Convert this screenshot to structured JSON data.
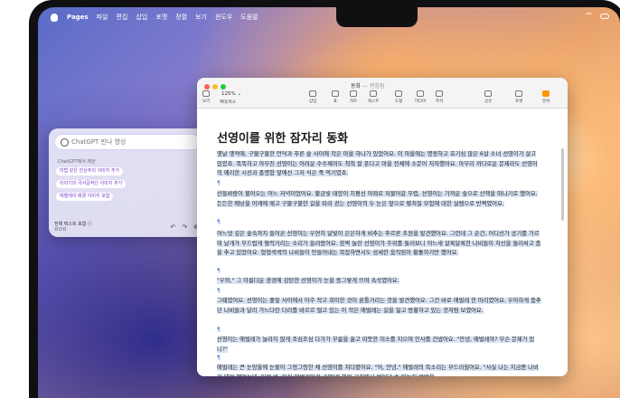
{
  "menubar": {
    "items": [
      "Pages",
      "파일",
      "편집",
      "삽입",
      "포맷",
      "정렬",
      "보기",
      "윈도우",
      "도움말"
    ]
  },
  "writing_tools": {
    "prompt_placeholder": "ChatGPT 만나 향상",
    "caption": "ChatGPT에서 제안",
    "suggestions": [
      "마법 같은 민상주의 이미지 추가",
      "이야기의 극서길적인 이미지 추가",
      "에벨레의 배경 이미지 포함"
    ],
    "footer_line1": "전체 텍스트 포함 ⓘ",
    "footer_line2": "ㅁㅁㅁ",
    "undo_icon": "↶",
    "redo_icon": "↷",
    "submit_icon": "⊕"
  },
  "window": {
    "title": "동화",
    "subtitle": "— 편집됨",
    "zoom": "125% ⌄",
    "toolbar_left": [
      "보기",
      "확대/축소"
    ],
    "toolbar_center": [
      "삽입",
      "표",
      "차트",
      "텍스트",
      "도형",
      "미디어",
      "주석"
    ],
    "toolbar_right": [
      "공유",
      "포맷",
      "문서"
    ],
    "colors": {
      "close": "#ff5f57",
      "minimize": "#febc2e",
      "maximize": "#28c840",
      "selection": "#d9e4f5"
    }
  },
  "document": {
    "title": "선영이를 위한 잠자리 동화",
    "pilcrow": "¶",
    "paragraphs": [
      "옛날 옛적에, 구불구불한 언덕과 푸른 숲 사이에 작은 마을 하나가 있었어요. 이 마을에는 명랑하고 호기심 많은 6살 소녀 선영이가 살고 있었죠. 똑똑하고 야무진 선영이는 어려운 수수께끼도 척척 잘 푼다고 마을 전체에 소문이 자자했어요. 아무리 까다로운 문제라도 선영이의 예리한 시선과 총명함 앞에선 그저 식은 죽 먹기였죠.",
      "산들바람이 불어오는 어느 저녁이었어요. 황금빛 태양이 지평선 아래로 저물어갈 무렵, 선영이는 가까운 숲으로 산책을 떠나기로 했어요. 든든한 배낭을 어깨에 메고 구불구불한 길을 따라 걷는 선영이의 두 눈은 앞으로 펼쳐질 모험에 대한 설렘으로 반짝였어요.",
      "어느덧 깊은 숲속까지 들어온 선영이는 우연히 달빛이 은은하게 비추는 푸르른 초원을 발견했어요. 그런데 그 순간, 어디선가 공기를 가르며 날개가 부드럽게 펄럭거리는 소리가 들려왔어요. 깜짝 놀란 선영이가 주위를 둘러보니 어느새 알록달록한 나비들이 자신을 둘러싸고 춤을 추고 있었어요. 형형색색의 나비들이 만들어내는 복잡하면서도 섬세한 움직임이 황홀하기만 했어요.",
      "\"우와,\" 그 아름다운 광경에 감탄한 선영이가 눈을 동그랗게 뜨며 속삭였어요.",
      "그때였어요. 선영이는 풀잎 사이에서 아주 작고 희미한 것이 꿈틀거리는 것을 발견했어요. 그건 바로 애벌레 한 마리였어요. 우아하게 춤추던 나비들과 달리 가느다란 다리를 바르르 떨고 있는 이 작은 애벌레는 길을 잃고 방황하고 있는 것처럼 보였어요.",
      "선영이는 애벌레가 놀라지 않게 조심조심 다가가 무릎을 꿇고 따뜻한 미소를 지으며 인사를 건넸어요. \"안녕, 애벌레야? 무슨 문제가 있니?\"",
      "애벌레는 큰 눈망울에 눈물이 그렁그렁한 채 선영이를 쳐다봤어요. \"어, 안녕,\" 애벌레의 목소리는 부드러웠어요. \"사실 나는 지금쯤 나비가 돼야 했었는데, 이런 봐, 아직 애벌레인걸. 어떻게 해야 고치에서 벗어날 수 있는지 방법을"
    ]
  }
}
